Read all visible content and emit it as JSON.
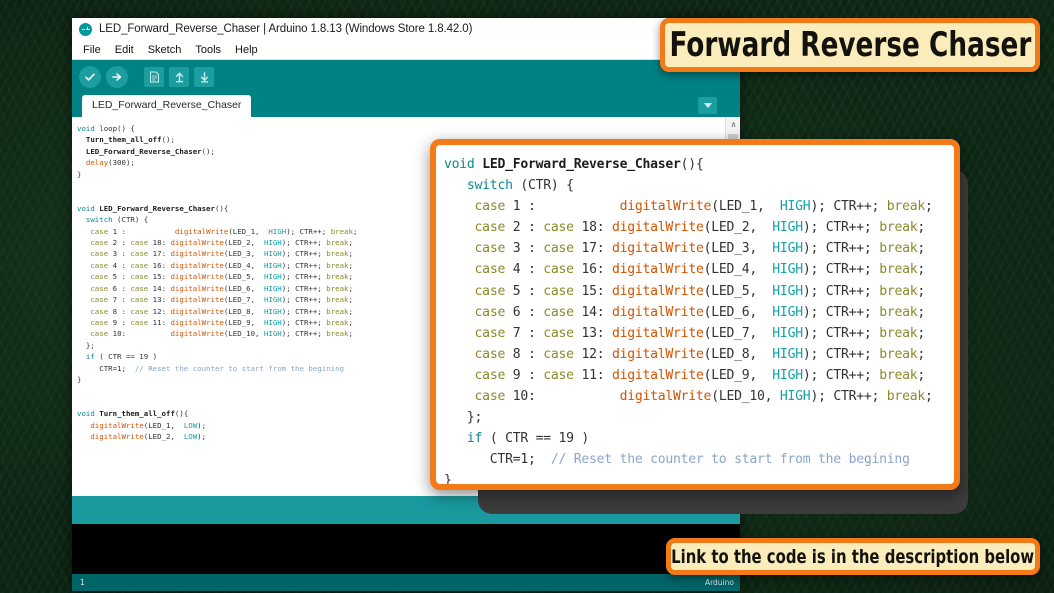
{
  "window": {
    "title": "LED_Forward_Reverse_Chaser | Arduino 1.8.13 (Windows Store 1.8.42.0)",
    "logo_name": "arduino-logo",
    "minimize_label": "−"
  },
  "menu": {
    "items": [
      {
        "label": "File"
      },
      {
        "label": "Edit"
      },
      {
        "label": "Sketch"
      },
      {
        "label": "Tools"
      },
      {
        "label": "Help"
      }
    ]
  },
  "toolbar": {
    "buttons": [
      {
        "name": "verify-button",
        "glyph": "✔",
        "title": "Verify"
      },
      {
        "name": "upload-button",
        "glyph": "→",
        "title": "Upload"
      },
      {
        "name": "new-button",
        "glyph": "▤",
        "title": "New"
      },
      {
        "name": "open-button",
        "glyph": "↑",
        "title": "Open"
      },
      {
        "name": "save-button",
        "glyph": "↓",
        "title": "Save"
      }
    ]
  },
  "tab": {
    "label": "LED_Forward_Reverse_Chaser",
    "dropdown_name": "editor-menu-dropdown"
  },
  "editor": {
    "scrollbar_up": "∧",
    "code_lines": [
      "void loop() {",
      "  Turn_them_all_off();",
      "  LED_Forward_Reverse_Chaser();",
      "  delay(300);",
      "}",
      "",
      "",
      "void LED_Forward_Reverse_Chaser(){",
      "  switch (CTR) {",
      "   case 1 :           digitalWrite(LED_1,  HIGH); CTR++; break;",
      "   case 2 : case 18: digitalWrite(LED_2,  HIGH); CTR++; break;",
      "   case 3 : case 17: digitalWrite(LED_3,  HIGH); CTR++; break;",
      "   case 4 : case 16: digitalWrite(LED_4,  HIGH); CTR++; break;",
      "   case 5 : case 15: digitalWrite(LED_5,  HIGH); CTR++; break;",
      "   case 6 : case 14: digitalWrite(LED_6,  HIGH); CTR++; break;",
      "   case 7 : case 13: digitalWrite(LED_7,  HIGH); CTR++; break;",
      "   case 8 : case 12: digitalWrite(LED_8,  HIGH); CTR++; break;",
      "   case 9 : case 11: digitalWrite(LED_9,  HIGH); CTR++; break;",
      "   case 10:          digitalWrite(LED_10, HIGH); CTR++; break;",
      "  };",
      "  if ( CTR == 19 )",
      "     CTR=1;  // Reset the counter to start from the begining",
      "}",
      "",
      "",
      "void Turn_them_all_off(){",
      "   digitalWrite(LED_1,  LOW);",
      "   digitalWrite(LED_2,  LOW);"
    ]
  },
  "overlay": {
    "name": "zoomed-code-panel",
    "code_lines": [
      "void LED_Forward_Reverse_Chaser(){",
      "   switch (CTR) {",
      "    case 1 :           digitalWrite(LED_1,  HIGH); CTR++; break;",
      "    case 2 : case 18: digitalWrite(LED_2,  HIGH); CTR++; break;",
      "    case 3 : case 17: digitalWrite(LED_3,  HIGH); CTR++; break;",
      "    case 4 : case 16: digitalWrite(LED_4,  HIGH); CTR++; break;",
      "    case 5 : case 15: digitalWrite(LED_5,  HIGH); CTR++; break;",
      "    case 6 : case 14: digitalWrite(LED_6,  HIGH); CTR++; break;",
      "    case 7 : case 13: digitalWrite(LED_7,  HIGH); CTR++; break;",
      "    case 8 : case 12: digitalWrite(LED_8,  HIGH); CTR++; break;",
      "    case 9 : case 11: digitalWrite(LED_9,  HIGH); CTR++; break;",
      "    case 10:           digitalWrite(LED_10, HIGH); CTR++; break;",
      "   };",
      "   if ( CTR == 19 )",
      "      CTR=1;  // Reset the counter to start from the begining",
      "}"
    ]
  },
  "status": {
    "left": "1",
    "right": "Arduino"
  },
  "banners": {
    "title": "Forward Reverse Chaser",
    "footer": "Link to the code is in the description below"
  },
  "colors": {
    "accent_orange": "#f47a17",
    "banner_cream": "#faedbb",
    "teal": "#008184",
    "teal_light": "#1a9a9e",
    "background_green": "#0c2410"
  }
}
